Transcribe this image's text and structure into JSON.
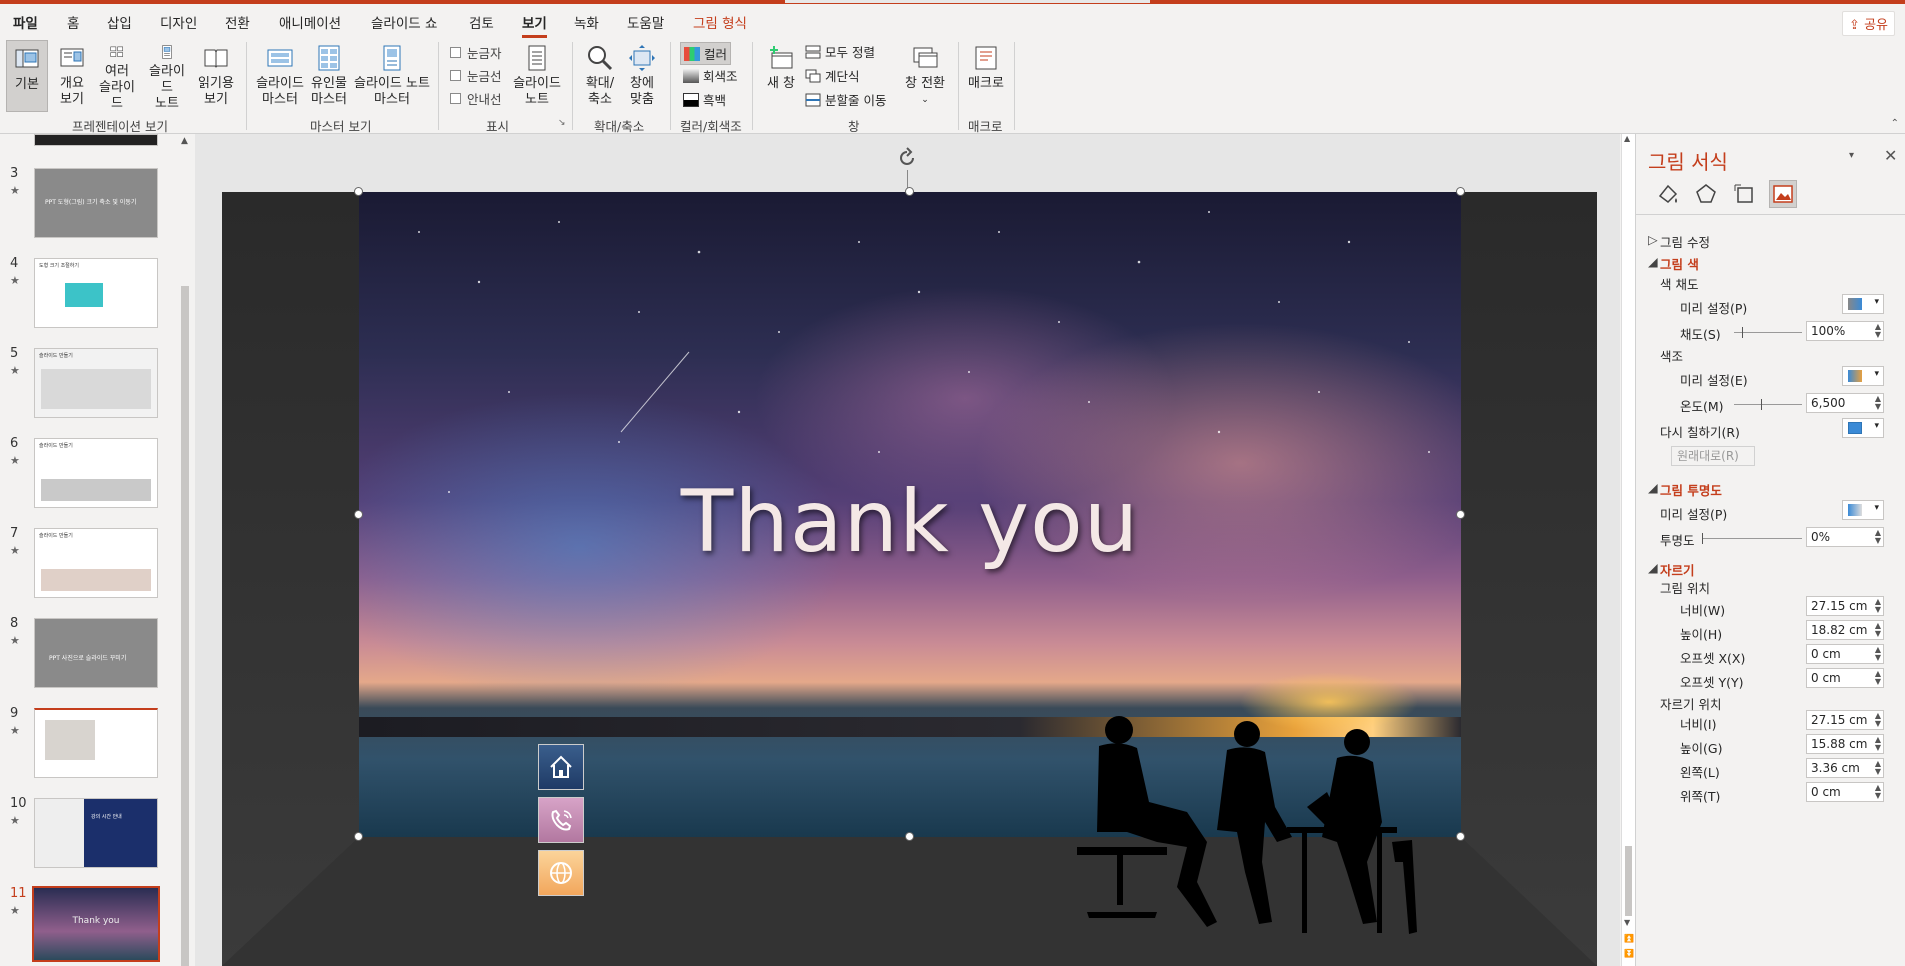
{
  "tabs": [
    "파일",
    "홈",
    "삽입",
    "디자인",
    "전환",
    "애니메이션",
    "슬라이드 쇼",
    "검토",
    "보기",
    "녹화",
    "도움말",
    "그림 형식"
  ],
  "share_label": "공유",
  "ribbon": {
    "groups": {
      "presentation_views": "프레젠테이션 보기",
      "master_views": "마스터 보기",
      "show": "표시",
      "zoom": "확대/축소",
      "color_gray": "컬러/회색조",
      "window": "창",
      "macro": "매크로"
    },
    "buttons": {
      "normal": "기본",
      "outline": "개요\n보기",
      "slide_sorter": "여러\n슬라이드",
      "notes_page": "슬라이드\n노트",
      "reading_view": "읽기용\n보기",
      "slide_master": "슬라이드\n마스터",
      "handout_master": "유인물\n마스터",
      "notes_master": "슬라이드 노트\n마스터",
      "notes": "슬라이드\n노트",
      "zoom": "확대/\n축소",
      "fit_window": "창에\n맞춤",
      "new_window": "새 창",
      "switch_windows": "창 전환",
      "macros": "매크로"
    },
    "checks": [
      "눈금자",
      "눈금선",
      "안내선"
    ],
    "color_options": [
      "컬러",
      "회색조",
      "흑백"
    ],
    "window_small": [
      "모두 정렬",
      "계단식",
      "분할줄 이동"
    ]
  },
  "thumbnails": [
    {
      "num": "3",
      "label": "PPT 도형(그림) 크기 축소 및 이동기"
    },
    {
      "num": "4",
      "label": "도형 크기 조절하기"
    },
    {
      "num": "5",
      "label": "슬라이드 만들기"
    },
    {
      "num": "6",
      "label": "슬라이드 만들기"
    },
    {
      "num": "7",
      "label": "슬라이드 만들기"
    },
    {
      "num": "8",
      "label": "PPT 사진으로 슬라이드 꾸미기"
    },
    {
      "num": "9",
      "label": ""
    },
    {
      "num": "10",
      "label": "강의 시간 안내"
    },
    {
      "num": "11",
      "label": "Thank you"
    }
  ],
  "slide": {
    "title": "Thank you"
  },
  "task_pane": {
    "title": "그림 서식",
    "sections": {
      "picture_corrections": "그림 수정",
      "picture_color": "그림 색",
      "saturation": "색 채도",
      "presets": "미리 설정(P)",
      "saturation_label": "채도(S)",
      "saturation_value": "100%",
      "tone": "색조",
      "presets_e": "미리 설정(E)",
      "temperature": "온도(M)",
      "temperature_value": "6,500",
      "recolor": "다시 칠하기(R)",
      "reset": "원래대로(R)",
      "transparency_sec": "그림 투명도",
      "presets_p2": "미리 설정(P)",
      "transparency": "투명도",
      "transparency_value": "0%",
      "crop": "자르기",
      "pic_position": "그림 위치",
      "width_w": "너비(W)",
      "width_w_value": "27.15 cm",
      "height_h": "높이(H)",
      "height_h_value": "18.82 cm",
      "offset_x": "오프셋 X(X)",
      "offset_x_value": "0 cm",
      "offset_y": "오프셋 Y(Y)",
      "offset_y_value": "0 cm",
      "crop_position": "자르기 위치",
      "width_i": "너비(I)",
      "width_i_value": "27.15 cm",
      "height_g": "높이(G)",
      "height_g_value": "15.88 cm",
      "left": "왼쪽(L)",
      "left_value": "3.36 cm",
      "top": "위쪽(T)",
      "top_value": "0 cm"
    }
  },
  "colors": {
    "accent": "#c43e1c"
  }
}
